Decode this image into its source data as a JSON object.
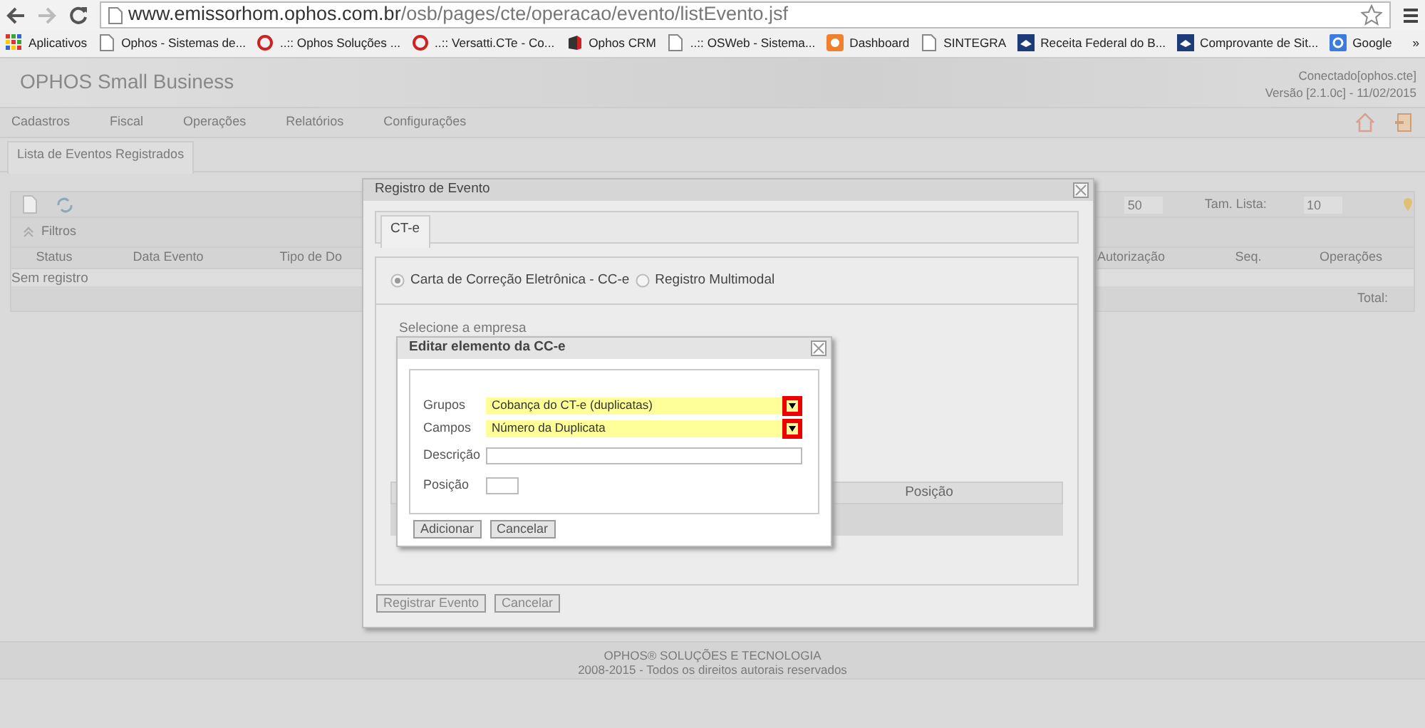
{
  "browser": {
    "url": {
      "host": "www.emissorhom.ophos.com.br",
      "path": "/osb/pages/cte/operacao/evento/listEvento.jsf"
    },
    "bookmarks": [
      {
        "kind": "apps",
        "label": "Aplicativos"
      },
      {
        "kind": "page",
        "label": "Ophos - Sistemas de..."
      },
      {
        "kind": "ring",
        "label": "..:: Ophos Soluções ..."
      },
      {
        "kind": "ring",
        "label": "..:: Versatti.CTe - Co..."
      },
      {
        "kind": "crm",
        "label": "Ophos CRM"
      },
      {
        "kind": "page",
        "label": "..:: OSWeb - Sistema..."
      },
      {
        "kind": "dash",
        "label": "Dashboard"
      },
      {
        "kind": "page",
        "label": "SINTEGRA"
      },
      {
        "kind": "gov",
        "label": "Receita Federal do B..."
      },
      {
        "kind": "gov",
        "label": "Comprovante de Sit..."
      },
      {
        "kind": "google",
        "label": "Google"
      }
    ],
    "more": "»"
  },
  "app": {
    "title": "OPHOS Small Business",
    "status": [
      "Conectado[ophos.cte]",
      "Versão [2.1.0c] - 11/02/2015"
    ],
    "menu": [
      "Cadastros",
      "Fiscal",
      "Operações",
      "Relatórios",
      "Configurações"
    ],
    "tabs": [
      {
        "label": "Lista de Eventos Registrados",
        "selected": true
      }
    ],
    "toolbar": {
      "page_value": "50",
      "list_size_label": "Tam. Lista:",
      "list_size_value": "10"
    },
    "filters": {
      "label": "Filtros",
      "expanded": true
    },
    "table": {
      "columns_left": [
        "Status",
        "Data Evento",
        "Tipo de Do"
      ],
      "columns_right": [
        "Autorização",
        "Seq.",
        "Operações"
      ],
      "empty": "Sem registro",
      "total_label": "Total:"
    },
    "footer": [
      "OPHOS® SOLUÇÕES E TECNOLOGIA",
      "2008-2015 - Todos os direitos autorais reservados"
    ]
  },
  "dialog": {
    "title": "Registro de Evento",
    "tabs": [
      {
        "label": "CT-e",
        "selected": true
      }
    ],
    "options": [
      {
        "label": "Carta de Correção Eletrônica - CC-e",
        "selected": true
      },
      {
        "label": "Registro Multimodal",
        "selected": false
      }
    ],
    "company_label": "Selecione a empresa",
    "table_column": "Posição",
    "buttons": [
      "Registrar Evento",
      "Cancelar"
    ]
  },
  "subdialog": {
    "title": "Editar elemento da CC-e",
    "fields": [
      {
        "kind": "select",
        "label": "Grupos",
        "value": "Cobança do CT-e (duplicatas)",
        "highlighted": true
      },
      {
        "kind": "select",
        "label": "Campos",
        "value": "Número da Duplicata",
        "highlighted": true
      },
      {
        "kind": "text",
        "label": "Descrição"
      },
      {
        "kind": "number",
        "label": "Posição"
      }
    ],
    "buttons": [
      "Adicionar",
      "Cancelar"
    ]
  }
}
